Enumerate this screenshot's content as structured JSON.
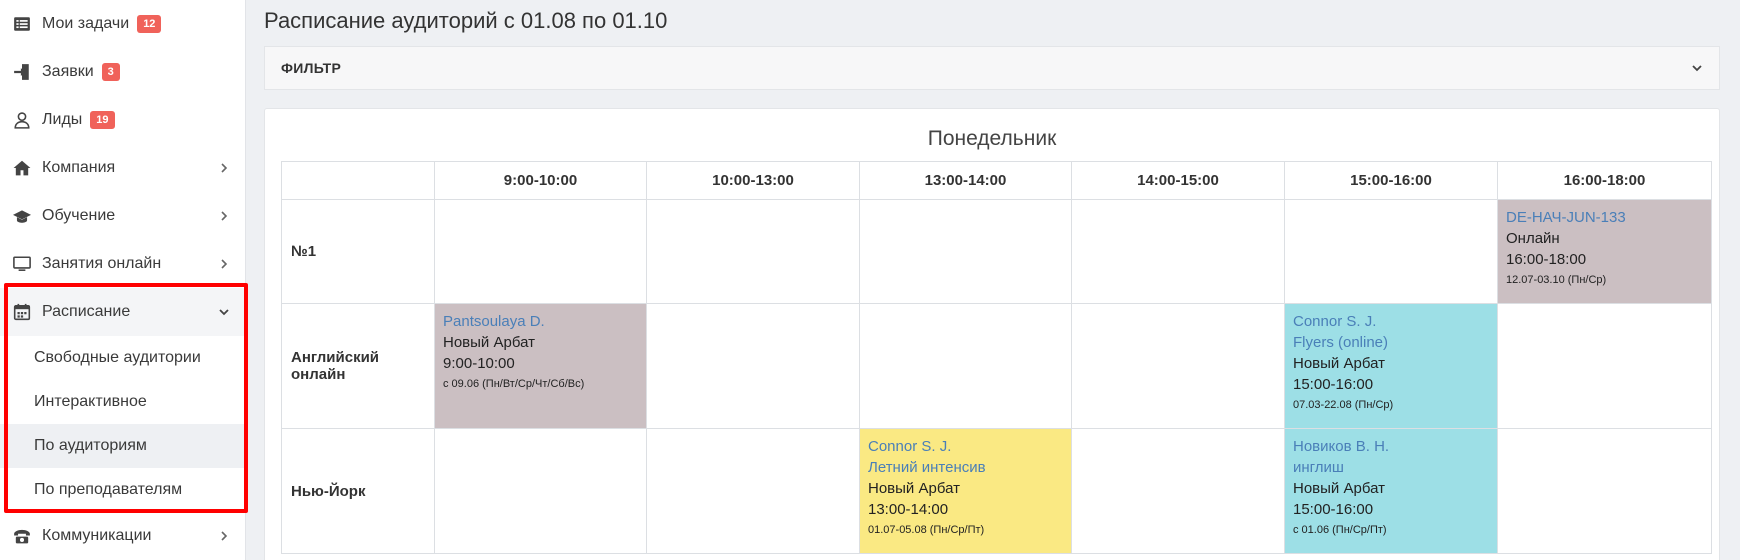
{
  "sidebar": {
    "items": [
      {
        "label": "Мои задачи",
        "badge": "12",
        "icon": "tasks-icon"
      },
      {
        "label": "Заявки",
        "badge": "3",
        "icon": "sign-in-icon"
      },
      {
        "label": "Лиды",
        "badge": "19",
        "icon": "user-icon"
      },
      {
        "label": "Компания",
        "icon": "home-icon"
      },
      {
        "label": "Обучение",
        "icon": "graduation-cap-icon"
      },
      {
        "label": "Занятия онлайн",
        "icon": "monitor-icon"
      },
      {
        "label": "Расписание",
        "icon": "calendar-icon"
      },
      {
        "label": "Коммуникации",
        "icon": "phone-icon"
      }
    ],
    "schedule_submenu": [
      {
        "label": "Свободные аудитории"
      },
      {
        "label": "Интерактивное"
      },
      {
        "label": "По аудиториям"
      },
      {
        "label": "По преподавателям"
      }
    ]
  },
  "main": {
    "title": "Расписание аудиторий с 01.08 по 01.10",
    "filter_label": "ФИЛЬТР",
    "day": "Понедельник",
    "time_slots": [
      "9:00-10:00",
      "10:00-13:00",
      "13:00-14:00",
      "14:00-15:00",
      "15:00-16:00",
      "16:00-18:00"
    ],
    "rooms": [
      "№1",
      "Английский онлайн",
      "Нью-Йорк"
    ],
    "events": {
      "r1_s6": {
        "link1": "DE-НАЧ-JUN-133",
        "place": "Онлайн",
        "time": "16:00-18:00",
        "dates": "12.07-03.10 (Пн/Ср)"
      },
      "r2_s1": {
        "link1": "Pantsoulaya D.",
        "place": "Новый Арбат",
        "time": "9:00-10:00",
        "dates": "с 09.06 (Пн/Вт/Ср/Чт/Сб/Вс)"
      },
      "r2_s5": {
        "link1": "Connor S. J.",
        "link2": "Flyers (online)",
        "place": "Новый Арбат",
        "time": "15:00-16:00",
        "dates": "07.03-22.08 (Пн/Ср)"
      },
      "r3_s3": {
        "link1": "Connor S. J.",
        "link2": "Летний интенсив",
        "place": "Новый Арбат",
        "time": "13:00-14:00",
        "dates": "01.07-05.08 (Пн/Ср/Пт)"
      },
      "r3_s5": {
        "link1": "Новиков В. Н.",
        "link2": "инглиш",
        "place": "Новый Арбат",
        "time": "15:00-16:00",
        "dates": "с 01.06 (Пн/Ср/Пт)"
      }
    }
  },
  "colors": {
    "badge": "#f0625a",
    "link": "#4a7fb8",
    "event_mauve": "#cbbfc2",
    "event_cyan": "#9ddfe6",
    "event_yellow": "#fae983",
    "highlight": "#ff0000"
  }
}
